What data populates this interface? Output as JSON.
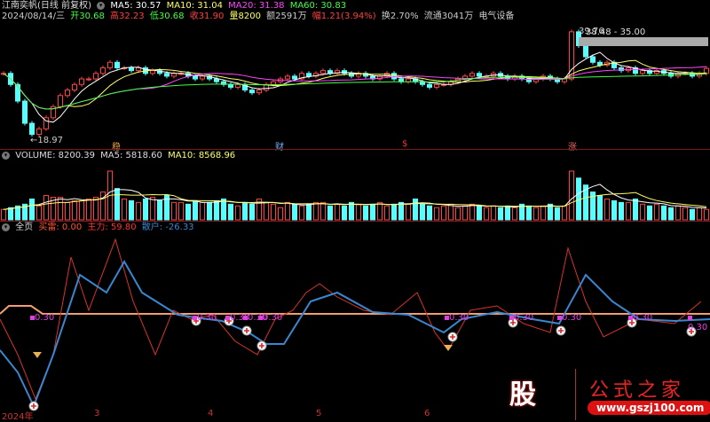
{
  "header": {
    "title": "江南奕帆(日线 前复权)",
    "ma5": "MA5: 30.57",
    "ma10": "MA10: 31.04",
    "ma20": "MA20: 31.38",
    "ma60": "MA60: 30.83",
    "date": "2024/08/14/三",
    "open": "开30.68",
    "high": "高32.23",
    "low": "低30.68",
    "close": "收31.90",
    "volume": "量8200",
    "amount": "额2591万",
    "change": "幅1.21(3.94%)",
    "turnover": "换2.70%",
    "float": "流通3041万",
    "sector": "电气设备"
  },
  "price_labels": {
    "high": "39.76",
    "high2": "38.48 - 35.00",
    "low": "18.97"
  },
  "main_markers": [
    "稳",
    "财",
    "$",
    "涨"
  ],
  "volume_header": {
    "volume": "VOLUME: 8200.39",
    "ma5": "MA5: 5818.60",
    "ma10": "MA10: 8568.96"
  },
  "indicator_header": {
    "name": "全页",
    "buy": "买雷: 0.00",
    "main": "主力: 59.80",
    "retail": "散户: -26.33"
  },
  "signal_label": "0.30",
  "x_axis": [
    "2024年",
    "3",
    "4",
    "5",
    "6"
  ],
  "logo": {
    "char": "股",
    "name": "公式之家",
    "url": "www.gszj100.com"
  },
  "colors": {
    "up": "#ff4040",
    "down": "#54ffff",
    "ma5": "#ffffff",
    "ma10": "#ffff66",
    "ma20": "#ff44ff",
    "ma60": "#44ff44",
    "main": "#d8332a",
    "retail": "#3a86d0",
    "signal": "#e040e0"
  },
  "chart_data": {
    "type": "candlestick",
    "closes": [
      31,
      29,
      26,
      22,
      20,
      21,
      23,
      25,
      27,
      28,
      29,
      30,
      30,
      31,
      32,
      33,
      32,
      32,
      31.5,
      32,
      31,
      31.5,
      31,
      30.5,
      31,
      31,
      30.5,
      30,
      30.5,
      30,
      29.5,
      29,
      28.5,
      29,
      28,
      27.5,
      28,
      29,
      29.5,
      30,
      30.5,
      30,
      31,
      30.5,
      31,
      31.5,
      31,
      31.5,
      31,
      30.5,
      31,
      30.5,
      30,
      30.5,
      31,
      30,
      29.5,
      30,
      29.5,
      29,
      28.5,
      29,
      29,
      29.5,
      30,
      30.5,
      31,
      30.5,
      30.5,
      31,
      30.5,
      30,
      30.5,
      30,
      29.5,
      30,
      30.5,
      30,
      29.5,
      30,
      38.5,
      36,
      34,
      33,
      32.5,
      33,
      32,
      31.5,
      32,
      31,
      31.5,
      31,
      31.5,
      31,
      30.5,
      31,
      31,
      30.5,
      31,
      31.9
    ],
    "volumes": [
      3000,
      3500,
      4000,
      4500,
      6000,
      4000,
      7000,
      6500,
      6500,
      5000,
      5500,
      5500,
      6000,
      6500,
      8000,
      14000,
      9000,
      6000,
      5500,
      5000,
      6000,
      6500,
      5500,
      7000,
      5000,
      5000,
      4500,
      5500,
      5000,
      5000,
      5500,
      6000,
      4500,
      4000,
      5000,
      4500,
      6000,
      5000,
      4500,
      3500,
      5000,
      4500,
      4000,
      4500,
      5000,
      5000,
      4000,
      4500,
      4000,
      5000,
      4500,
      4000,
      4500,
      5000,
      4000,
      4500,
      5000,
      4500,
      6000,
      4500,
      4000,
      3500,
      4000,
      4500,
      3500,
      4000,
      4500,
      4000,
      3500,
      4000,
      3500,
      4000,
      3500,
      4500,
      4000,
      3500,
      4000,
      4500,
      3500,
      4000,
      14000,
      12000,
      10000,
      8000,
      7000,
      6000,
      5500,
      5000,
      5000,
      6000,
      4500,
      4000,
      4500,
      4000,
      3500,
      4000,
      3500,
      3000,
      3500,
      3000
    ],
    "price_range": [
      18.97,
      39.76
    ],
    "indicator": {
      "retail_x": [
        0,
        20,
        38,
        60,
        90,
        120,
        140,
        160,
        200,
        220,
        250,
        280,
        300,
        320,
        350,
        380,
        420,
        460,
        500,
        520,
        560,
        600,
        630,
        660,
        690,
        720,
        760,
        800
      ],
      "retail": [
        -41,
        -66,
        -104,
        -46,
        44,
        24,
        59,
        24,
        -1,
        -4,
        -8,
        -21,
        -34,
        -34,
        14,
        24,
        2,
        -1,
        -21,
        -6,
        2,
        -6,
        -11,
        44,
        14,
        -6,
        -8,
        -6
      ],
      "main_x": [
        0,
        20,
        40,
        60,
        80,
        100,
        130,
        150,
        175,
        195,
        215,
        240,
        265,
        290,
        310,
        330,
        345,
        360,
        380,
        410,
        440,
        470,
        490,
        505,
        530,
        560,
        590,
        620,
        640,
        660,
        680,
        720,
        760,
        790
      ],
      "main": [
        -6,
        -46,
        -96,
        -46,
        64,
        4,
        84,
        14,
        -46,
        4,
        -6,
        -1,
        -31,
        -46,
        -6,
        4,
        24,
        34,
        19,
        4,
        -1,
        24,
        -21,
        -41,
        4,
        9,
        -11,
        -21,
        74,
        14,
        -26,
        -6,
        -11,
        14
      ]
    }
  }
}
